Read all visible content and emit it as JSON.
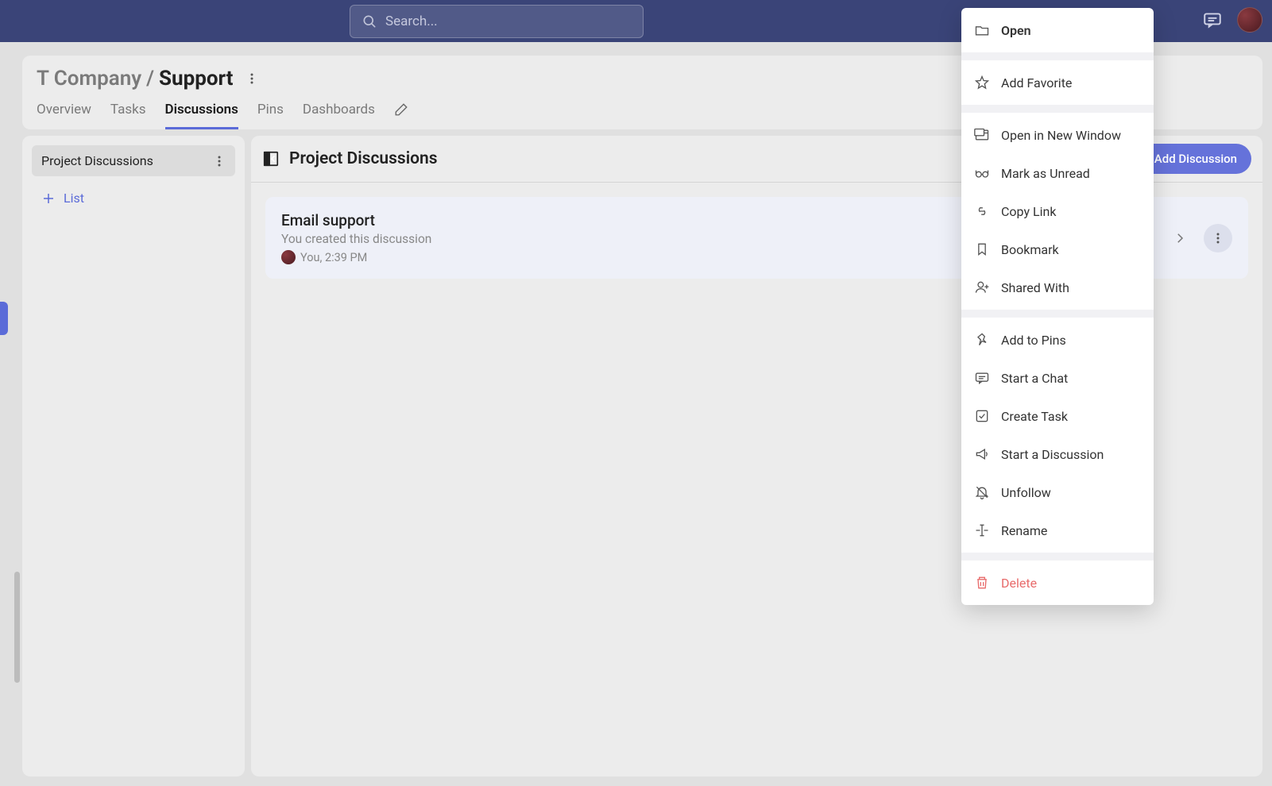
{
  "topbar": {
    "search_placeholder": "Search..."
  },
  "breadcrumb": {
    "parent": "T Company",
    "separator": " / ",
    "current": "Support"
  },
  "tabs": [
    {
      "label": "Overview",
      "active": false
    },
    {
      "label": "Tasks",
      "active": false
    },
    {
      "label": "Discussions",
      "active": true
    },
    {
      "label": "Pins",
      "active": false
    },
    {
      "label": "Dashboards",
      "active": false
    }
  ],
  "sidebar": {
    "items": [
      {
        "label": "Project Discussions"
      }
    ],
    "add_label": "List"
  },
  "main": {
    "title": "Project Discussions",
    "add_button": "+ Add Discussion"
  },
  "discussion": {
    "title": "Email support",
    "subtitle": "You created this discussion",
    "meta": "You, 2:39 PM"
  },
  "context_menu": {
    "groups": [
      [
        {
          "key": "open",
          "label": "Open",
          "icon": "folder-open-icon",
          "bold": true
        }
      ],
      [
        {
          "key": "favorite",
          "label": "Add Favorite",
          "icon": "star-icon"
        }
      ],
      [
        {
          "key": "new_window",
          "label": "Open in New Window",
          "icon": "window-icon"
        },
        {
          "key": "unread",
          "label": "Mark as Unread",
          "icon": "glasses-icon"
        },
        {
          "key": "copy_link",
          "label": "Copy Link",
          "icon": "link-icon"
        },
        {
          "key": "bookmark",
          "label": "Bookmark",
          "icon": "bookmark-icon"
        },
        {
          "key": "shared_with",
          "label": "Shared With",
          "icon": "user-plus-icon"
        }
      ],
      [
        {
          "key": "add_pins",
          "label": "Add to Pins",
          "icon": "pin-icon"
        },
        {
          "key": "start_chat",
          "label": "Start a Chat",
          "icon": "chat-icon"
        },
        {
          "key": "create_task",
          "label": "Create Task",
          "icon": "task-icon"
        },
        {
          "key": "start_discussion",
          "label": "Start a Discussion",
          "icon": "megaphone-icon"
        },
        {
          "key": "unfollow",
          "label": "Unfollow",
          "icon": "bell-off-icon"
        },
        {
          "key": "rename",
          "label": "Rename",
          "icon": "rename-icon"
        }
      ],
      [
        {
          "key": "delete",
          "label": "Delete",
          "icon": "trash-icon",
          "danger": true
        }
      ]
    ]
  }
}
